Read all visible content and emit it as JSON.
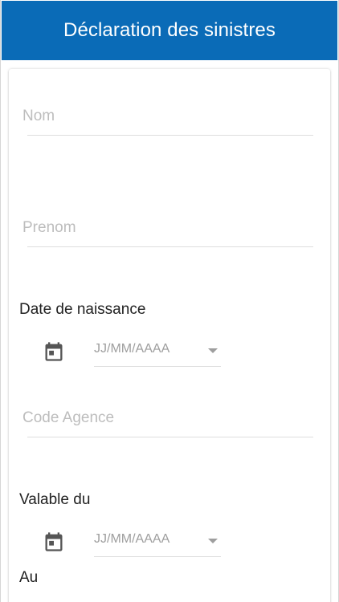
{
  "header": {
    "title": "Déclaration des sinistres",
    "color": "#0a6bb7"
  },
  "form": {
    "nom": {
      "placeholder": "Nom"
    },
    "prenom": {
      "placeholder": "Prenom"
    },
    "date_naissance": {
      "label": "Date de naissance",
      "placeholder": "JJ/MM/AAAA",
      "icon": "calendar-icon"
    },
    "code_agence": {
      "placeholder": "Code Agence"
    },
    "valable_du": {
      "label": "Valable du",
      "placeholder": "JJ/MM/AAAA",
      "icon": "calendar-icon"
    },
    "au": {
      "label": "Au"
    }
  }
}
